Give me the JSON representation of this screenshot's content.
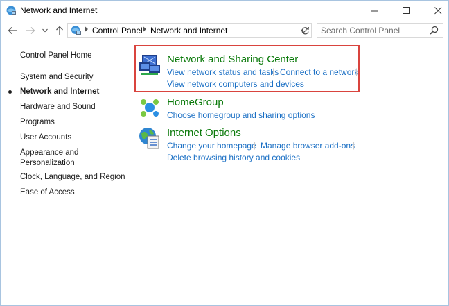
{
  "window": {
    "title": "Network and Internet"
  },
  "address_bar": {
    "breadcrumbs": [
      "Control Panel",
      "Network and Internet"
    ]
  },
  "search": {
    "placeholder": "Search Control Panel"
  },
  "left_nav": {
    "items": [
      {
        "label": "Control Panel Home",
        "active": false
      },
      {
        "label": "System and Security",
        "active": false
      },
      {
        "label": "Network and Internet",
        "active": true
      },
      {
        "label": "Hardware and Sound",
        "active": false
      },
      {
        "label": "Programs",
        "active": false
      },
      {
        "label": "User Accounts",
        "active": false
      },
      {
        "label": "Appearance and",
        "active": false
      },
      {
        "label": "Personalization",
        "active": false
      },
      {
        "label": "Clock, Language, and Region",
        "active": false
      },
      {
        "label": "Ease of Access",
        "active": false
      }
    ]
  },
  "categories": [
    {
      "title": "Network and Sharing Center",
      "icon": "network-sharing-center-icon",
      "links": [
        "View network status and tasks",
        "Connect to a network",
        "View network computers and devices"
      ]
    },
    {
      "title": "HomeGroup",
      "icon": "homegroup-icon",
      "links": [
        "Choose homegroup and sharing options"
      ]
    },
    {
      "title": "Internet Options",
      "icon": "internet-options-icon",
      "links": [
        "Change your homepage",
        "Manage browser add-ons",
        "Delete browsing history and cookies"
      ]
    }
  ],
  "colors": {
    "category_title": "#0b7a0b",
    "link": "#1a6fc4",
    "highlight_border": "#d9443e"
  }
}
